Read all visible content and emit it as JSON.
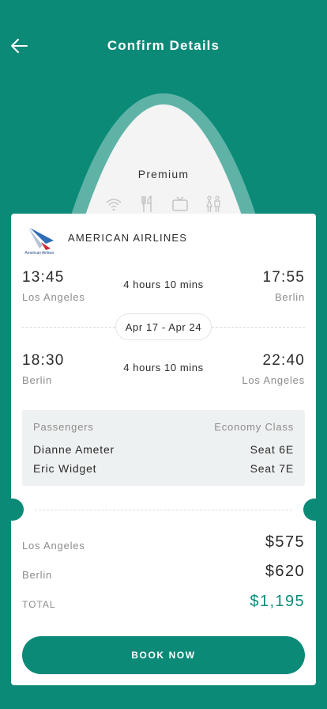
{
  "header": {
    "title": "Confirm Details",
    "back_icon": "arrow-left-icon"
  },
  "cabin": {
    "label": "Premium",
    "amenities": [
      "wifi-icon",
      "cutlery-icon",
      "tv-icon",
      "restroom-icon"
    ]
  },
  "airline": {
    "name": "AMERICAN AIRLINES",
    "logo_text": "American Airlines"
  },
  "outbound": {
    "dep_time": "13:45",
    "dep_city": "Los Angeles",
    "duration": "4 hours 10 mins",
    "arr_time": "17:55",
    "arr_city": "Berlin"
  },
  "dates": "Apr 17 - Apr 24",
  "return": {
    "dep_time": "18:30",
    "dep_city": "Berlin",
    "duration": "4 hours 10 mins",
    "arr_time": "22:40",
    "arr_city": "Los Angeles"
  },
  "passengers": {
    "header_left": "Passengers",
    "header_right": "Economy Class",
    "list": [
      {
        "name": "Dianne Ameter",
        "seat": "Seat 6E"
      },
      {
        "name": "Eric Widget",
        "seat": "Seat 7E"
      }
    ]
  },
  "prices": [
    {
      "label": "Los Angeles",
      "value": "$575"
    },
    {
      "label": "Berlin",
      "value": "$620"
    }
  ],
  "total": {
    "label": "TOTAL",
    "value": "$1,195"
  },
  "book_button": "BOOK NOW",
  "colors": {
    "accent": "#0b8a78",
    "background": "#0b8a78",
    "card": "#ffffff"
  }
}
